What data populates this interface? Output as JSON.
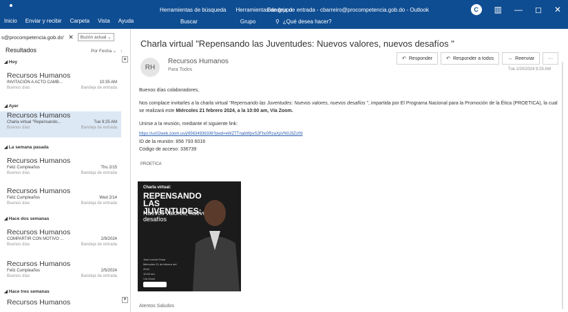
{
  "ribbon": {
    "tabs": [
      "Inicio",
      "Enviar y recibir",
      "Carpeta",
      "Vista",
      "Ayuda"
    ],
    "context_top": [
      "Herramientas de búsqueda",
      "Herramientas de grupo"
    ],
    "context_bottom": [
      "Buscar",
      "Grupo"
    ],
    "window_title": "Bandeja de entrada - cbarreiro@procompetencia.gob.do - Outlook",
    "search_placeholder": "¿Qué desea hacer?",
    "user_initial": "C",
    "min_glyph": "—",
    "restore_glyph": "◻",
    "close_glyph": "✕",
    "layout_glyph": "▥"
  },
  "search": {
    "query": "s@procompetencia.gob.do'",
    "close": "✕",
    "scope": "Buzón actual ⌄"
  },
  "results": {
    "title": "Resultados",
    "sort": "Por Fecha ⌄",
    "sort_arrow": "↑"
  },
  "groups": {
    "hoy": "◢ Hoy",
    "ayer": "◢ Ayer",
    "semana_pasada": "◢ La semana pasada",
    "dos_semanas": "◢ Hace dos semanas",
    "tres_semanas": "◢ Hace tres semanas"
  },
  "mails": [
    {
      "from": "Recursos Humanos",
      "subject": "INVITACIÓN A ACTO CAMB...",
      "time": "10:35 AM",
      "preview": "Buenos días",
      "folder": "Bandeja de entrada"
    },
    {
      "from": "Recursos Humanos",
      "subject": "Charla virtual \"Repensando...",
      "time": "Tue 9:25 AM",
      "preview": "Buenos días",
      "folder": "Bandeja de entrada"
    },
    {
      "from": "Recursos Humanos",
      "subject": "Feliz Cumpleaños",
      "time": "Thu 2/15",
      "preview": "Buenos días",
      "folder": "Bandeja de entrada"
    },
    {
      "from": "Recursos Humanos",
      "subject": "Feliz Cumpleaños",
      "time": "Wed 2/14",
      "preview": "Buenos días",
      "folder": "Bandeja de entrada"
    },
    {
      "from": "Recursos Humanos",
      "subject": "COMPARTIR CON MOTIVO ...",
      "time": "2/9/2024",
      "preview": "Buenos días",
      "folder": "Bandeja de entrada"
    },
    {
      "from": "Recursos Humanos",
      "subject": "Feliz Cumpleaños",
      "time": "2/5/2024",
      "preview": "Buenos días",
      "folder": "Bandeja de entrada"
    },
    {
      "from": "Recursos Humanos",
      "subject": "",
      "time": "",
      "preview": "",
      "folder": ""
    }
  ],
  "message": {
    "subject": "Charla virtual \"Repensando las Juventudes: Nuevos valores, nuevos desafíos \"",
    "avatar": "RH",
    "sender": "Recursos Humanos",
    "to": "Para   Todos",
    "datetime": "Tue 2/20/2024 9:25 AM",
    "reply": "Responder",
    "reply_all": "Responder a todos",
    "forward": "Reenviar",
    "more": "···",
    "greeting": "Buenos días colaboradores,",
    "p1_a": "Nos complace invitarles a la charla virtual ",
    "p1_b": "\"Repensando las Juventudes: Nuevos valores, nuevos desafíos \"",
    "p1_c": ", impartida por El Programa Nacional para la Promoción de la Ética (PROETICA), la cual se realizará este ",
    "p1_d": "Miércoles 21 febrero 2024, a la 10:00 am, Vía Zoom.",
    "p2": "Unirse a la reunión, mediante el siguiente link:",
    "link": "https://us02web.zoom.us/j/85634936336?pwd=eWZTTnabWpvS2Fhc0RzaXpVN0J3Zz09",
    "meeting_id": "ID de la reunión: 856 793 6016",
    "passcode": "Código de acceso: 336739",
    "signature": "Atentos Saludos"
  },
  "flyer": {
    "org": "PROETICA",
    "label": "Charla virtual:",
    "title": "REPENSANDO LAS JUVENTUDES:",
    "subtitle": "Nuevos valores, nuevos desafíos",
    "speaker": "Juan Leonel Sosa",
    "details": [
      "Miércoles 21 de febrero del 2024",
      "10:00 am",
      "Vía Zoom"
    ]
  }
}
